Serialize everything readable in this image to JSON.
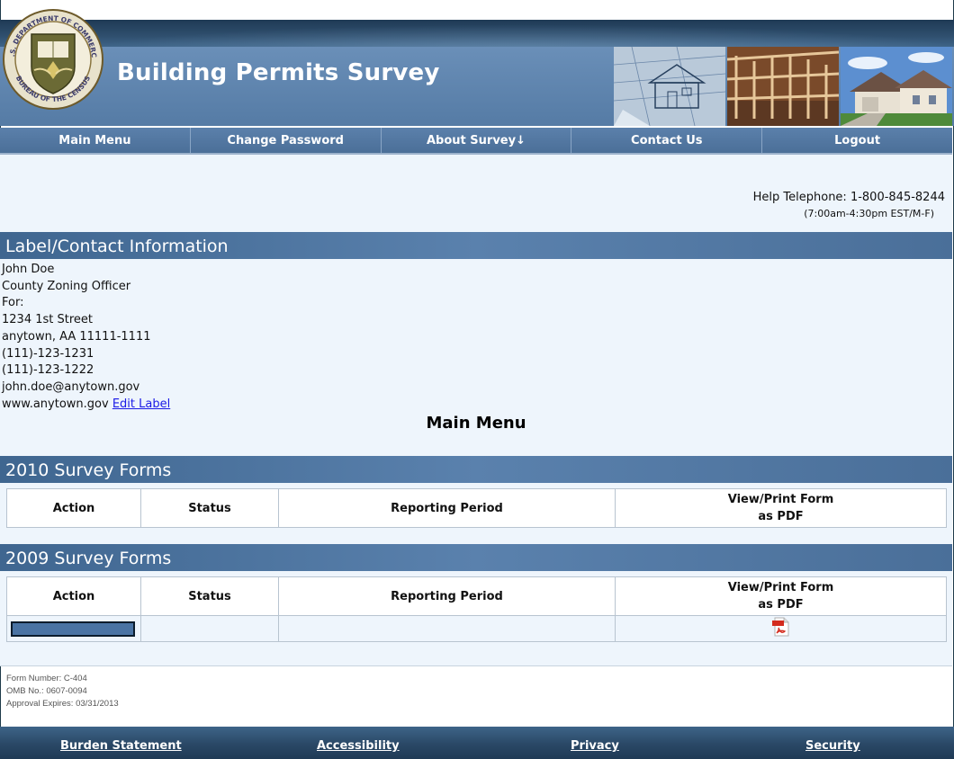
{
  "header": {
    "title": "Building Permits Survey",
    "seal_text_top": "U.S. DEPARTMENT OF COMMERCE",
    "seal_text_bottom": "BUREAU OF THE CENSUS"
  },
  "nav": [
    {
      "label": "Main Menu"
    },
    {
      "label": "Change Password"
    },
    {
      "label": "About Survey↓"
    },
    {
      "label": "Contact Us"
    },
    {
      "label": "Logout"
    }
  ],
  "help": {
    "telephone": "Help Telephone: 1-800-845-8244",
    "hours": "(7:00am-4:30pm EST/M-F)"
  },
  "contact": {
    "section_title": "Label/Contact Information",
    "name": "John Doe",
    "title": "County Zoning Officer",
    "for": "For:",
    "street": "1234 1st Street",
    "city": "anytown, AA 11111-1111",
    "phone1": "(111)-123-1231",
    "phone2": "(111)-123-1222",
    "email": "john.doe@anytown.gov",
    "website": "www.anytown.gov",
    "edit_link": "Edit Label"
  },
  "main_menu_title": "Main Menu",
  "survey_2010": {
    "section_title": "2010 Survey Forms",
    "columns": [
      "Action",
      "Status",
      "Reporting Period",
      "View/Print Form",
      "as PDF"
    ]
  },
  "survey_2009": {
    "section_title": "2009 Survey Forms",
    "columns": [
      "Action",
      "Status",
      "Reporting Period",
      "View/Print Form",
      "as PDF"
    ]
  },
  "form_meta": {
    "form_number": "Form Number: C-404",
    "omb": "OMB No.: 0607-0094",
    "expires": "Approval Expires: 03/31/2013"
  },
  "footer": {
    "burden": "Burden Statement",
    "accessibility": "Accessibility",
    "privacy": "Privacy",
    "security": "Security"
  }
}
